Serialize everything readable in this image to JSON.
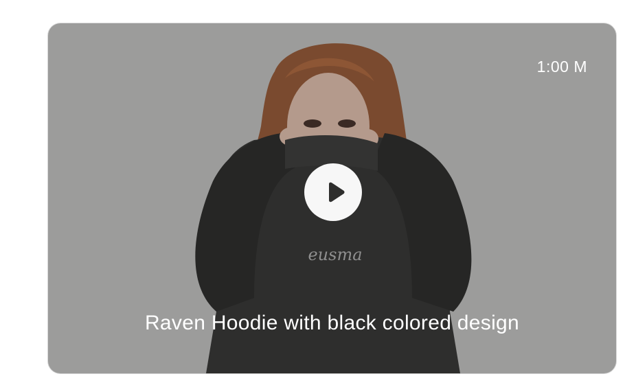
{
  "video": {
    "duration_label": "1:00 M",
    "title": "Raven Hoodie with black colored design",
    "logo_text": "eusma",
    "play_icon": "play-icon",
    "overlay_color": "#9c9c9b",
    "hoodie_color": "#2c2c2b",
    "hair_color": "#8a4e2e",
    "skin_color": "#b89888"
  }
}
